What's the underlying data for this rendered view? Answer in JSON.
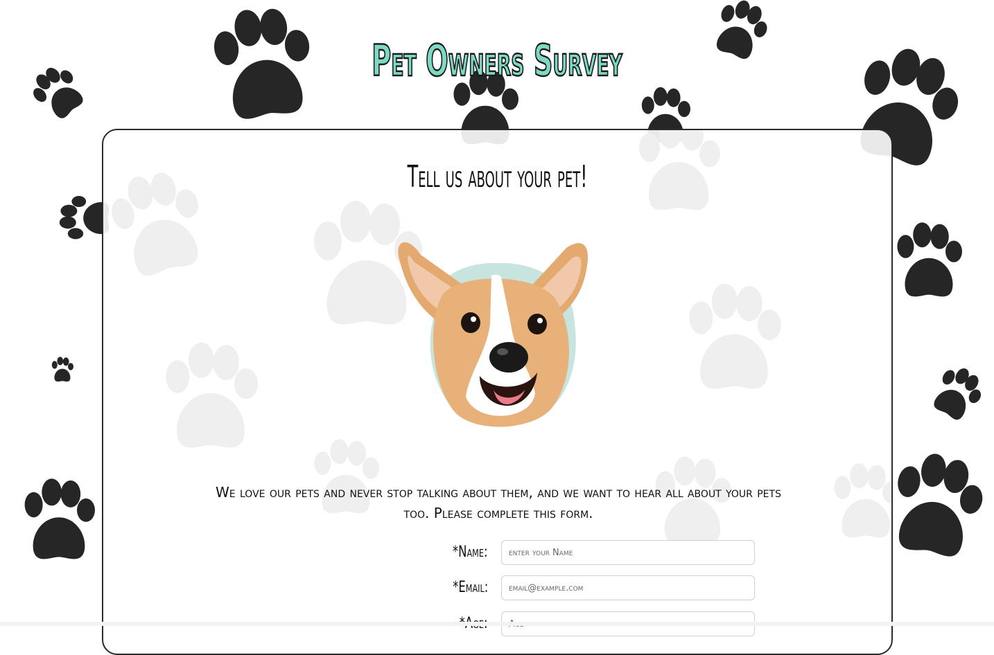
{
  "title": "Pet Owners Survey",
  "card": {
    "heading": "Tell us about your pet!",
    "intro": "We love our pets and never stop talking about them, and we want to hear all about your pets too. Please complete this form."
  },
  "form": {
    "name": {
      "label": "*Name:",
      "placeholder": "enter your Name"
    },
    "email": {
      "label": "*Email:",
      "placeholder": "email@example.com"
    },
    "age": {
      "label": "*Age:",
      "placeholder": "Age"
    }
  },
  "colors": {
    "title_fill": "#7ed9c4",
    "paw": "#262626",
    "paw_faint": "#efefef"
  },
  "icons": {
    "paw": "paw-print-icon",
    "dog": "corgi-illustration"
  }
}
